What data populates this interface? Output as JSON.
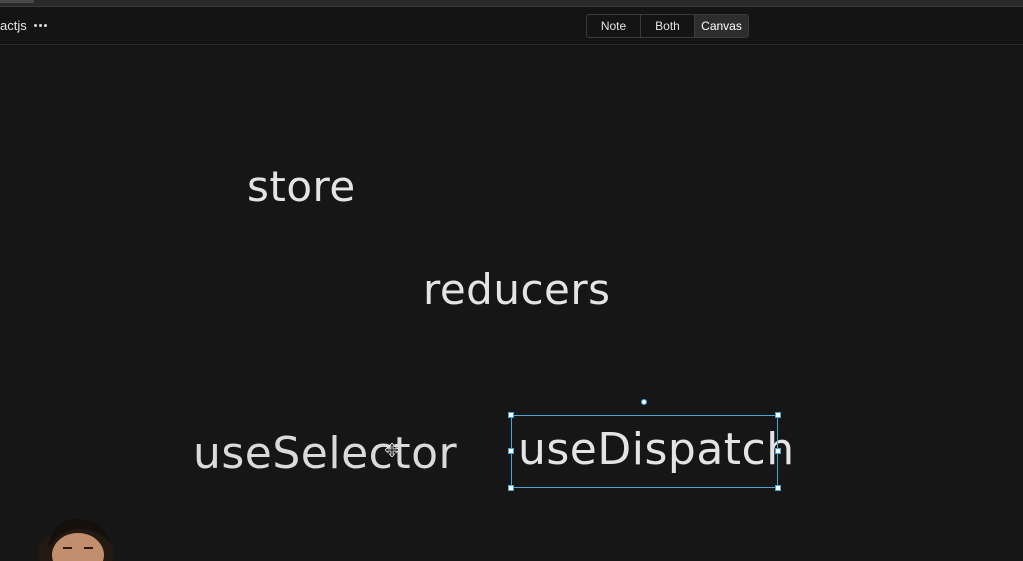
{
  "header": {
    "title": "actjs",
    "views": [
      {
        "label": "Note",
        "active": false
      },
      {
        "label": "Both",
        "active": false
      },
      {
        "label": "Canvas",
        "active": true
      }
    ]
  },
  "canvas": {
    "texts": {
      "store": "store",
      "reducers": "reducers",
      "use_selector": "useSelector",
      "use_dispatch": "useDispatch"
    },
    "selected_item": "useDispatch"
  },
  "colors": {
    "background": "#161616",
    "selection": "#49a6d6",
    "text": "#e4e4e4"
  }
}
